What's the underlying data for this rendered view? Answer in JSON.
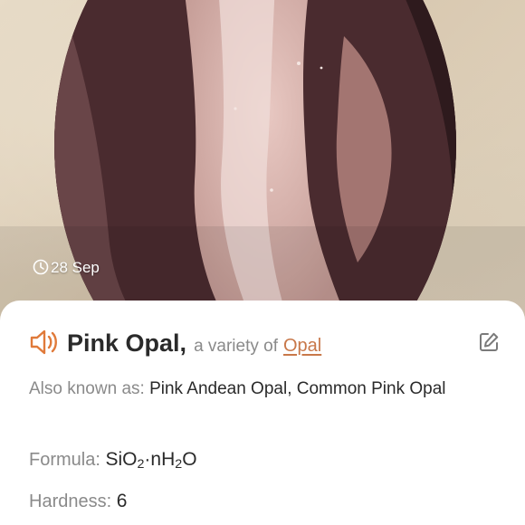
{
  "photo": {
    "date": "28 Sep"
  },
  "stone": {
    "name": "Pink Opal",
    "variety_prefix": "a variety of",
    "variety_link": "Opal"
  },
  "properties": {
    "aka_label": "Also known as:",
    "aka_value": "Pink Andean Opal, Common Pink Opal",
    "formula_label": "Formula:",
    "formula_parts": [
      "SiO",
      "2",
      "·nH",
      "2",
      "O"
    ],
    "hardness_label": "Hardness:",
    "hardness_value": "6"
  },
  "colors": {
    "accent": "#e07a3a",
    "link": "#c8784a",
    "label": "#8a8a8a",
    "text": "#2a2a2a"
  },
  "icons": [
    "clock-icon",
    "speaker-icon",
    "edit-icon"
  ]
}
